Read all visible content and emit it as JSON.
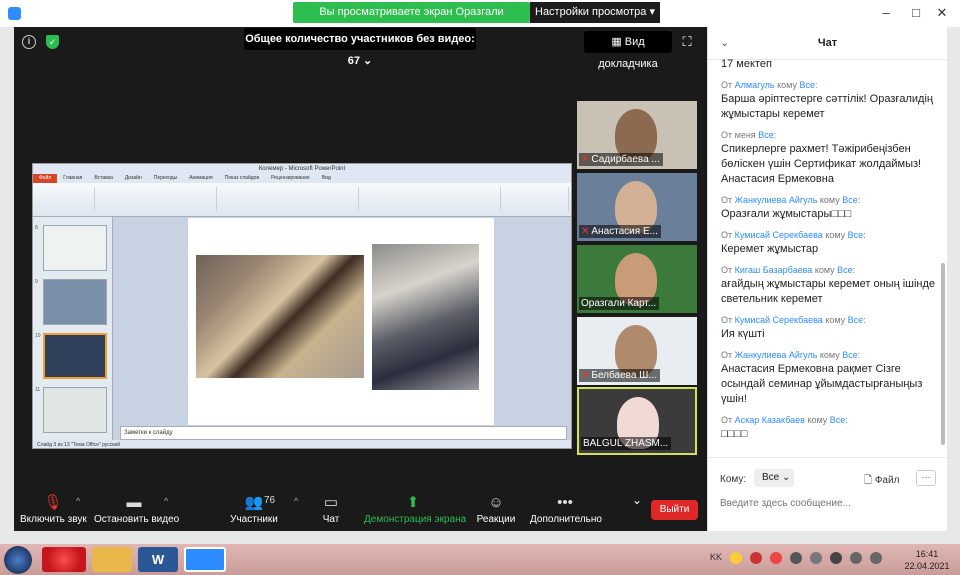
{
  "window": {
    "share_banner": "Вы просматриваете экран Оразгали  Картжанов",
    "view_settings": "Настройки просмотра ▾"
  },
  "meeting": {
    "participants_banner": "Общее количество участников без видео: 67",
    "speaker_view": "Вид докладчика",
    "fullscreen_icon": "⛶"
  },
  "presentation": {
    "title": "Колемер - Microsoft PowerPoint",
    "tabs": [
      "Файл",
      "Главная",
      "Вставка",
      "Дизайн",
      "Переходы",
      "Анимация",
      "Показ слайдов",
      "Рецензирование",
      "Вид"
    ],
    "thumb_numbers": [
      "8",
      "9",
      "10",
      "11"
    ],
    "notes": "Заметки к слайду",
    "status": "Слайд 3 из 13   \"Тема Office\"   русский"
  },
  "tiles": [
    {
      "name": "Садирбаева ...",
      "muted": true,
      "bg": "#c9c2b4",
      "face": "#8b6a4f"
    },
    {
      "name": "Анастасия Е...",
      "muted": true,
      "bg": "#6a7f9a",
      "face": "#d2b095"
    },
    {
      "name": "Оразгали  Карт...",
      "muted": false,
      "bg": "#3b7a3b",
      "face": "#c99b76"
    },
    {
      "name": "Белбаева Ш...",
      "muted": true,
      "bg": "#e8edf2",
      "face": "#b08a6c"
    },
    {
      "name": "BALGUL ZHASM...",
      "muted": false,
      "bg": "#3b3b3b",
      "face": "#f1d9d6"
    }
  ],
  "toolbar": {
    "unmute": "Включить звук",
    "stop_video": "Остановить видео",
    "participants": "Участники",
    "participants_count": "76",
    "chat": "Чат",
    "share": "Демонстрация экрана",
    "reactions": "Реакции",
    "more": "Дополнительно",
    "leave": "Выйти"
  },
  "chat": {
    "title": "Чат",
    "first_line": "17 мектеп",
    "messages": [
      {
        "from": "Алмагуль",
        "to": "Все",
        "text": "Барша әріптестерге сәттілік! Оразғалидің жұмыстары керемет",
        "from_prefix": "От ",
        "to_prefix": " кому "
      },
      {
        "from": "меня",
        "to": "Все",
        "text": "Спикерлерге рахмет! Тәжірибеңізбен бөліскен үшін Сертификат жолдаймыз! Анастасия Ермековна",
        "from_prefix": "От ",
        "to_prefix": " "
      },
      {
        "from": "Жанкулиева Айгуль",
        "to": "Все",
        "text": "Оразғали жұмыстары□□□",
        "from_prefix": "От ",
        "to_prefix": " кому "
      },
      {
        "from": "Кумисай Серекбаева",
        "to": "Все",
        "text": "Керемет жұмыстар",
        "from_prefix": "От ",
        "to_prefix": " кому "
      },
      {
        "from": "Кигаш Базарбаева",
        "to": "Все",
        "text": "ағайдың жұмыстары керемет оның ішінде светельник керемет",
        "from_prefix": "От ",
        "to_prefix": " кому "
      },
      {
        "from": "Кумисай Серекбаева",
        "to": "Все",
        "text": "Ия күшті",
        "from_prefix": "От ",
        "to_prefix": " кому "
      },
      {
        "from": "Жанкулиева Айгуль",
        "to": "Все",
        "text": "Анастасия Ермековна рақмет Сізге осындай семинар ұйымдастырғаныңыз үшін!",
        "from_prefix": "От ",
        "to_prefix": " кому "
      },
      {
        "from": "Аскар Казакбаев",
        "to": "Все",
        "text": "□□□□",
        "from_prefix": "От ",
        "to_prefix": " кому "
      }
    ],
    "to_label": "Кому:",
    "to_value": "Все",
    "file_label": "Файл",
    "placeholder": "Введите здесь сообщение..."
  },
  "taskbar": {
    "lang": "KK",
    "time": "16:41",
    "date": "22.04.2021"
  }
}
